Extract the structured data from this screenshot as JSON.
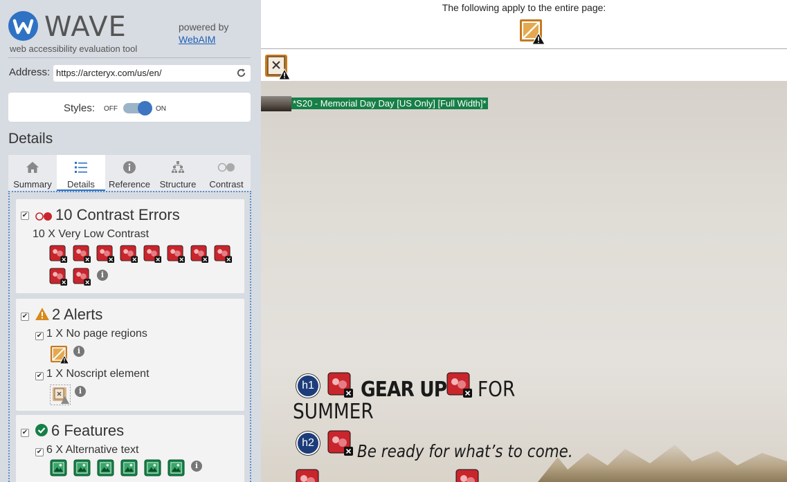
{
  "sidebar": {
    "logo_title": "WAVE",
    "logo_subtitle": "web accessibility evaluation tool",
    "powered_by": "powered by",
    "webaim_link": "WebAIM",
    "address_label": "Address:",
    "address_value": "https://arcteryx.com/us/en/",
    "styles_label": "Styles:",
    "styles_off": "OFF",
    "styles_on": "ON",
    "styles_enabled": true,
    "details_heading": "Details",
    "tabs": [
      {
        "label": "Summary",
        "icon": "home-icon"
      },
      {
        "label": "Details",
        "icon": "list-icon",
        "active": true
      },
      {
        "label": "Reference",
        "icon": "info-icon"
      },
      {
        "label": "Structure",
        "icon": "sitemap-icon"
      },
      {
        "label": "Contrast",
        "icon": "contrast-icon"
      }
    ],
    "sections": {
      "contrast": {
        "title": "10 Contrast Errors",
        "item": "10 X Very Low Contrast",
        "count": 10
      },
      "alerts": {
        "title": "2 Alerts",
        "items": [
          "1 X No page regions",
          "1 X Noscript element"
        ]
      },
      "features": {
        "title": "6 Features",
        "item": "6 X Alternative text",
        "count": 6
      }
    }
  },
  "main": {
    "page_note": "The following apply to the entire page:",
    "hero_alt_text": "*S20 - Memorial Day Day [US Only] [Full Width]*",
    "heading_bold": "GEAR UP",
    "heading_for": "FOR",
    "heading_summer": "SUMMER",
    "h1_badge": "h1",
    "h2_badge": "h2",
    "tagline": "Be ready for what’s to come.",
    "colors": {
      "contrast_error": "#c9252c",
      "alert": "#d88a1c",
      "feature": "#167f47",
      "heading_badge": "#1d3d7a",
      "accent": "#2f72c4"
    }
  }
}
